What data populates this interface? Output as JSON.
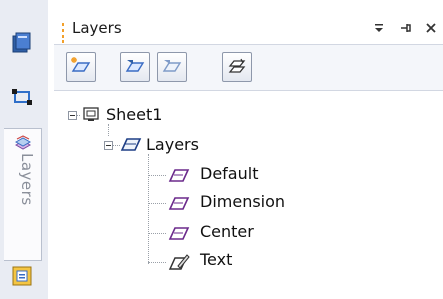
{
  "panel": {
    "title": "Layers",
    "title_buttons": [
      "dropdown-icon",
      "pin-icon",
      "close-icon"
    ]
  },
  "side_bar": {
    "tab_label": "Layers",
    "icons": [
      "blue-book-icon",
      "dimension-icon",
      "layers-tab-icon",
      "properties-icon"
    ]
  },
  "toolbar": {
    "buttons": [
      "new-layer-icon",
      "set-active-layer-icon",
      "layer-visibility-icon",
      "layer-properties-icon"
    ]
  },
  "tree": {
    "root": {
      "label": "Sheet1",
      "icon": "sheet-icon",
      "expanded": true
    },
    "group": {
      "label": "Layers",
      "icon": "layer-group-icon",
      "expanded": true
    },
    "layers": [
      {
        "label": "Default",
        "icon": "layer-icon"
      },
      {
        "label": "Dimension",
        "icon": "layer-icon"
      },
      {
        "label": "Center",
        "icon": "layer-icon"
      },
      {
        "label": "Text",
        "icon": "layer-edit-icon"
      }
    ]
  },
  "colors": {
    "accent_orange": "#f2a02b",
    "layer_purple": "#6b2a8c",
    "toolbar_blue": "#3a6cc4"
  }
}
